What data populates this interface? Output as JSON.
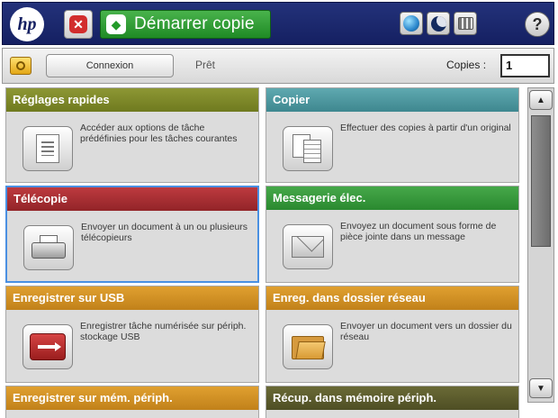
{
  "topbar": {
    "logo": "hp",
    "start_label": "Démarrer copie",
    "help_label": "?"
  },
  "statusbar": {
    "login_label": "Connexion",
    "status": "Prêt",
    "copies_label": "Copies :",
    "copies_value": "1"
  },
  "tiles": [
    {
      "title": "Réglages rapides",
      "desc": "Accéder aux options de tâche prédéfinies pour les tâches courantes",
      "color": "#7d8a29",
      "icon": "document-icon"
    },
    {
      "title": "Copier",
      "desc": "Effectuer des copies à partir d'un original",
      "color": "#4e97a0",
      "icon": "copy-icon"
    },
    {
      "title": "Télécopie",
      "desc": "Envoyer un document à un ou plusieurs télécopieurs",
      "color": "#a82f35",
      "icon": "fax-icon"
    },
    {
      "title": "Messagerie élec.",
      "desc": "Envoyez un document sous forme de pièce jointe dans un message",
      "color": "#3a9b3f",
      "icon": "envelope-icon"
    },
    {
      "title": "Enregistrer sur USB",
      "desc": "Enregistrer tâche numérisée sur périph. stockage USB",
      "color": "#d59127",
      "icon": "usb-icon"
    },
    {
      "title": "Enreg. dans dossier réseau",
      "desc": "Envoyer un document vers un dossier du réseau",
      "color": "#d59127",
      "icon": "folder-icon"
    },
    {
      "title": "Enregistrer sur mém. périph.",
      "desc": "",
      "color": "#d59127",
      "icon": ""
    },
    {
      "title": "Récup. dans mémoire périph.",
      "desc": "",
      "color": "#5c5c2d",
      "icon": ""
    }
  ],
  "scroll_position": 0.0
}
